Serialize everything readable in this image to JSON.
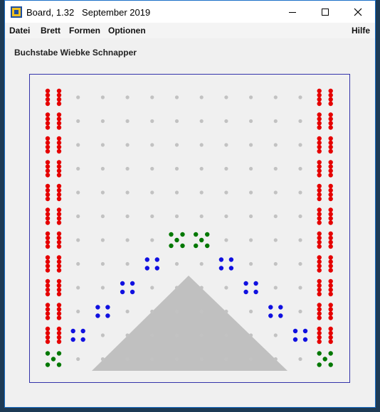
{
  "window": {
    "title": "Board, 1.32   September 2019",
    "controls": {
      "minimize": "minimize-icon",
      "maximize": "maximize-icon",
      "close": "close-icon"
    }
  },
  "menu": {
    "left": [
      "Datei",
      "Brett",
      "Formen",
      "Optionen"
    ],
    "right": "Hilfe"
  },
  "heading": "Buchstabe Wiebke Schnapper",
  "board": {
    "columns": 12,
    "rows": 12,
    "colors": {
      "empty": "#c2c2c2",
      "red": "#e50000",
      "blue": "#1010e0",
      "green": "#007800",
      "triangle": "#c0c0c0",
      "frame": "#3333aa"
    },
    "cells": [
      "RggggggggggR",
      "RggggggggggR",
      "RggggggggggR",
      "RggggggggggR",
      "RggggggggggR",
      "RggggggggggR",
      "RggggGGggggR",
      "RgggBggBgggR",
      "RggBggggBggR",
      "RgBggggggBgR",
      "RBggggggggBR",
      "GggggggggggG"
    ],
    "cell_kinds": {
      "R": "red-four",
      "B": "blue-four",
      "G": "green-five",
      "g": "gray-dot"
    }
  }
}
